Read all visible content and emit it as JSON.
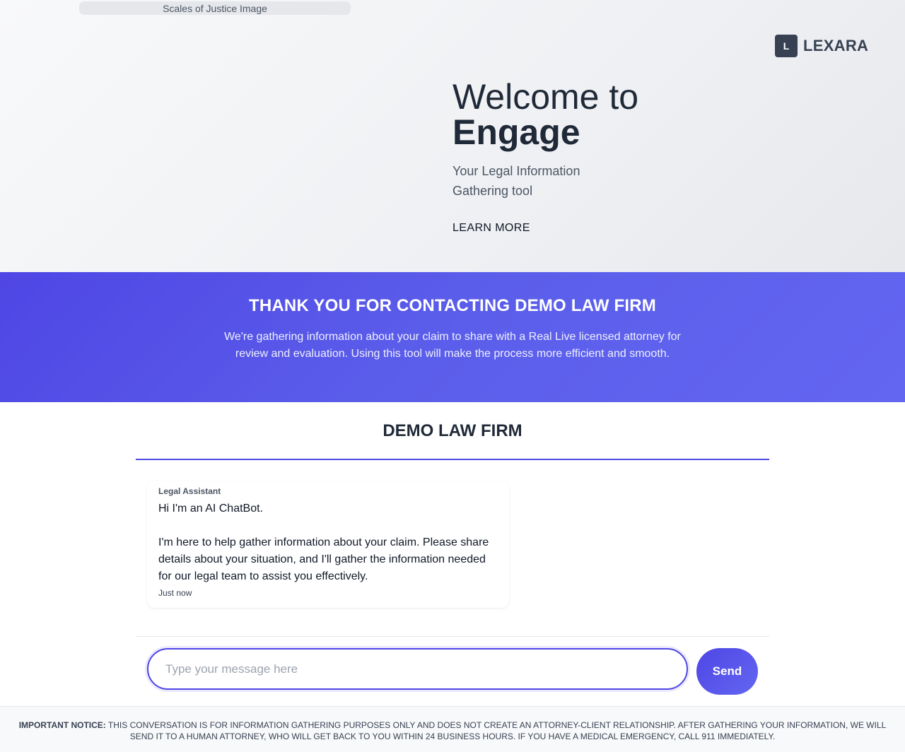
{
  "hero": {
    "image_alt": "Scales of Justice Image",
    "brand_mark": "L",
    "brand_name": "LEXARA",
    "welcome": "Welcome to",
    "product": "Engage",
    "tagline": "Your Legal Information Gathering tool",
    "learn_more": "LEARN MORE"
  },
  "banner": {
    "title": "THANK YOU FOR CONTACTING DEMO LAW FIRM",
    "text": "We're gathering information about your claim to share with a Real Live licensed attorney for review and evaluation. Using this tool will make the process more efficient and smooth."
  },
  "chat": {
    "firm_name": "DEMO LAW FIRM",
    "messages": [
      {
        "sender": "Legal Assistant",
        "line1": "Hi I'm an AI ChatBot.",
        "line2": "I'm here to help gather information about your claim. Please share details about your situation, and I'll gather the information needed for our legal team to assist you effectively.",
        "time": "Just now"
      }
    ],
    "input_placeholder": "Type your message here",
    "send_label": "Send"
  },
  "notice": {
    "label": "IMPORTANT NOTICE:",
    "text": "THIS CONVERSATION IS FOR INFORMATION GATHERING PURPOSES ONLY AND DOES NOT CREATE AN ATTORNEY-CLIENT RELATIONSHIP. AFTER GATHERING YOUR INFORMATION, WE WILL SEND IT TO A HUMAN ATTORNEY, WHO WILL GET BACK TO YOU WITHIN 24 BUSINESS HOURS. IF YOU HAVE A MEDICAL EMERGENCY, CALL 911 IMMEDIATELY."
  },
  "colors": {
    "accent": "#4f46e5",
    "brand_dark": "#374151"
  }
}
